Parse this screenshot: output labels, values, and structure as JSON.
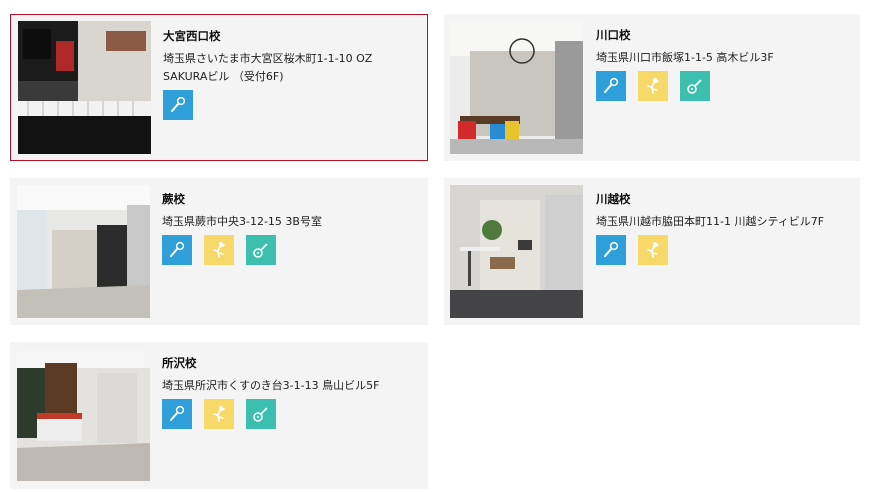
{
  "schools": [
    {
      "name": "大宮西口校",
      "address": "埼玉県さいたま市大宮区桜木町1-1-10 OZ SAKURAビル （受付6F)",
      "courses": [
        "mic-icon"
      ],
      "photo": "piano-room-photo"
    },
    {
      "name": "川口校",
      "address": "埼玉県川口市飯塚1-1-5 高木ビル3F",
      "courses": [
        "mic-icon",
        "dance-icon",
        "guitar-icon"
      ],
      "photo": "lounge-photo"
    },
    {
      "name": "蕨校",
      "address": "埼玉県蕨市中央3-12-15 3B号室",
      "courses": [
        "mic-icon",
        "dance-icon",
        "guitar-icon"
      ],
      "photo": "studio-entrance-photo"
    },
    {
      "name": "川越校",
      "address": "埼玉県川越市脇田本町11-1 川越シティビル7F",
      "courses": [
        "mic-icon",
        "dance-icon"
      ],
      "photo": "lounge-stools-photo"
    },
    {
      "name": "所沢校",
      "address": "埼玉県所沢市くすのき台3-1-13 鳥山ビル5F",
      "courses": [
        "mic-icon",
        "dance-icon",
        "guitar-icon"
      ],
      "photo": "reception-photo"
    }
  ],
  "colors": {
    "card_bg": "#f4f4f4",
    "selected_border": "#b5122a",
    "vocal": "#2e9fd8",
    "dance": "#f7d96a",
    "guitar": "#3cbfae"
  }
}
